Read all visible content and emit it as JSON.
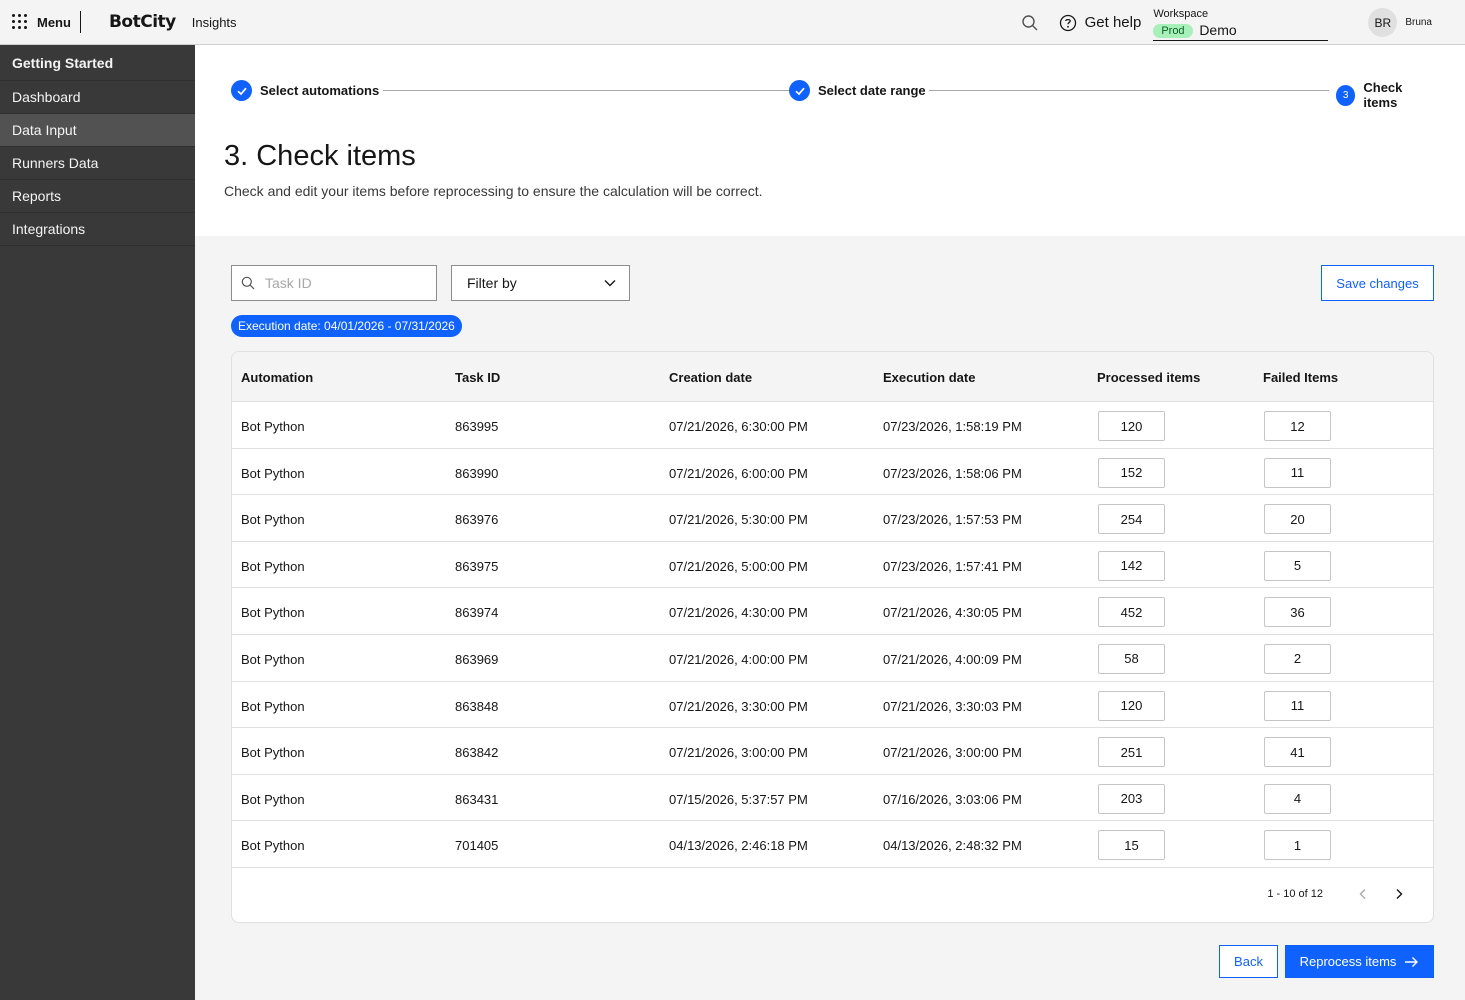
{
  "header": {
    "menu_label": "Menu",
    "logo": "BotCity",
    "product": "Insights",
    "help_label": "Get help",
    "workspace_label": "Workspace",
    "workspace_env": "Prod",
    "workspace_value": "Demo",
    "avatar_initials": "BR",
    "username": "Bruna"
  },
  "sidebar": {
    "items": [
      {
        "label": "Getting Started"
      },
      {
        "label": "Dashboard"
      },
      {
        "label": "Data Input"
      },
      {
        "label": "Runners Data"
      },
      {
        "label": "Reports"
      },
      {
        "label": "Integrations"
      }
    ]
  },
  "steps": [
    {
      "label": "Select automations",
      "state": "done"
    },
    {
      "label": "Select date range",
      "state": "done"
    },
    {
      "label": "Check items",
      "state": "current",
      "number": "3"
    }
  ],
  "page": {
    "title": "3. Check items",
    "description": "Check and edit your items before reprocessing to ensure the calculation will be correct."
  },
  "toolbar": {
    "search_placeholder": "Task ID",
    "filter_label": "Filter by",
    "save_label": "Save changes",
    "date_tag": "Execution date: 04/01/2026 - 07/31/2026"
  },
  "table": {
    "columns": [
      "Automation",
      "Task ID",
      "Creation date",
      "Execution date",
      "Processed items",
      "Failed Items"
    ],
    "rows": [
      [
        "Bot Python",
        "863995",
        "07/21/2026, 6:30:00 PM",
        "07/23/2026, 1:58:19 PM",
        "120",
        "12"
      ],
      [
        "Bot Python",
        "863990",
        "07/21/2026, 6:00:00 PM",
        "07/23/2026, 1:58:06 PM",
        "152",
        "11"
      ],
      [
        "Bot Python",
        "863976",
        "07/21/2026, 5:30:00 PM",
        "07/23/2026, 1:57:53 PM",
        "254",
        "20"
      ],
      [
        "Bot Python",
        "863975",
        "07/21/2026, 5:00:00 PM",
        "07/23/2026, 1:57:41 PM",
        "142",
        "5"
      ],
      [
        "Bot Python",
        "863974",
        "07/21/2026, 4:30:00 PM",
        "07/21/2026, 4:30:05 PM",
        "452",
        "36"
      ],
      [
        "Bot Python",
        "863969",
        "07/21/2026, 4:00:00 PM",
        "07/21/2026, 4:00:09 PM",
        "58",
        "2"
      ],
      [
        "Bot Python",
        "863848",
        "07/21/2026, 3:30:00 PM",
        "07/21/2026, 3:30:03 PM",
        "120",
        "11"
      ],
      [
        "Bot Python",
        "863842",
        "07/21/2026, 3:00:00 PM",
        "07/21/2026, 3:00:00 PM",
        "251",
        "41"
      ],
      [
        "Bot Python",
        "863431",
        "07/15/2026, 5:37:57 PM",
        "07/16/2026, 3:03:06 PM",
        "203",
        "4"
      ],
      [
        "Bot Python",
        "701405",
        "04/13/2026, 2:46:18 PM",
        "04/13/2026, 2:48:32 PM",
        "15",
        "1"
      ]
    ],
    "pagination": "1 - 10 of 12"
  },
  "footer": {
    "back_label": "Back",
    "reprocess_label": "Reprocess items"
  },
  "colors": {
    "primary": "#0f62fe",
    "sidebar": "#393939",
    "sidebar_active": "#525252",
    "badge_bg": "#a7f0ba"
  }
}
